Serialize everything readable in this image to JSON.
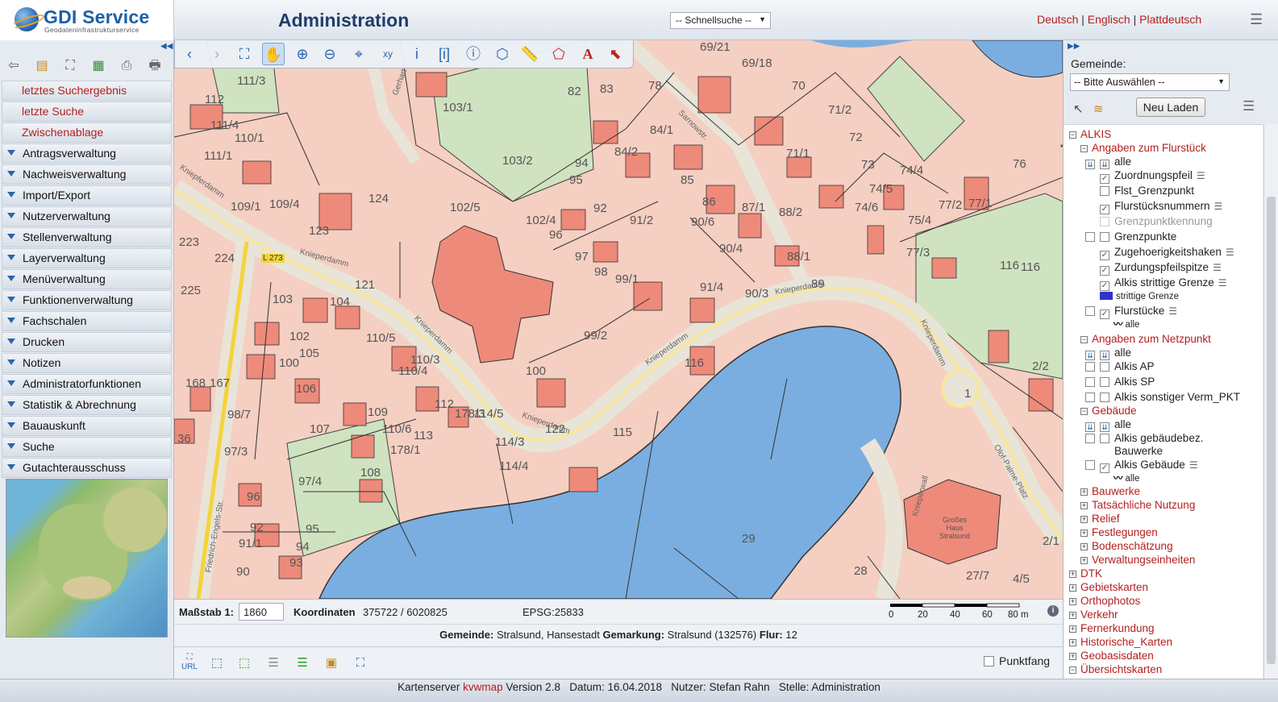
{
  "header": {
    "logo_name": "GDI Service",
    "logo_sub": "Geodateninfrastrukturservice",
    "title": "Administration",
    "quicksearch": "-- Schnellsuche --",
    "languages": [
      "Deutsch",
      "Englisch",
      "Plattdeutsch"
    ]
  },
  "sidebar": {
    "quick_links": [
      "letztes Suchergebnis",
      "letzte Suche",
      "Zwischenablage"
    ],
    "menu": [
      "Antragsverwaltung",
      "Nachweisverwaltung",
      "Import/Export",
      "Nutzerverwaltung",
      "Stellenverwaltung",
      "Layerverwaltung",
      "Menüverwaltung",
      "Funktionenverwaltung",
      "Fachschalen",
      "Drucken",
      "Notizen",
      "Administratorfunktionen",
      "Statistik & Abrechnung",
      "Bauauskunft",
      "Suche",
      "Gutachterausschuss"
    ]
  },
  "map": {
    "parcel_labels": [
      "111/3",
      "112",
      "111/4",
      "110/1",
      "111/1",
      "109/1",
      "109/4",
      "103/1",
      "103/2",
      "124",
      "102/5",
      "102/4",
      "123",
      "103/",
      "96",
      "95",
      "94",
      "92",
      "91/2",
      "84/1",
      "84/2",
      "85",
      "86",
      "90/6",
      "87/1",
      "88/2",
      "70",
      "71/2",
      "72",
      "71/1",
      "73",
      "74/4",
      "74/5",
      "74/6",
      "75/4",
      "77/2",
      "77/1",
      "77/3",
      "116",
      "76",
      "69/21",
      "69/18",
      "78",
      "82",
      "83",
      "97",
      "98",
      "99/1",
      "90/4",
      "91/4",
      "90/3",
      "88/1",
      "89",
      "223",
      "224",
      "225",
      "121",
      "103",
      "104",
      "102",
      "105",
      "100",
      "106",
      "107",
      "109",
      "110/5",
      "110/3",
      "110/4",
      "110/6",
      "112",
      "113",
      "114/5",
      "114/3",
      "114/4",
      "178/3",
      "178/1",
      "99/2",
      "100",
      "122",
      "116",
      "115",
      "108",
      "97/4",
      "168",
      "167",
      "98/7",
      "97/3",
      "36",
      "96",
      "95",
      "92",
      "91/1",
      "94",
      "93",
      "90",
      "29",
      "28",
      "27/7",
      "4/5",
      "2/1",
      "2/2",
      "1",
      "116"
    ],
    "street_labels": [
      "Kniepferdamm",
      "Knieperdamm",
      "Sarnowstr.",
      "Friedrich-Engels-Str.",
      "Olof-Palme-Platz",
      "Knieperwall",
      "Gerhart-"
    ],
    "building_label": "Großes Haus Stralsund",
    "road_ref": "L 273"
  },
  "status": {
    "scale_label": "Maßstab 1:",
    "scale_value": "1860",
    "coord_label": "Koordinaten",
    "coord_value": "375722 / 6020825",
    "epsg": "EPSG:25833",
    "scalebar_ticks": [
      "0",
      "20",
      "40",
      "60",
      "80 m"
    ],
    "location_text_1": "Gemeinde:",
    "location_val_1": "Stralsund, Hansestadt",
    "location_text_2": "Gemarkung:",
    "location_val_2": "Stralsund (132576)",
    "location_text_3": "Flur:",
    "location_val_3": "12",
    "punktfang": "Punktfang"
  },
  "right_panel": {
    "gemeinde_label": "Gemeinde:",
    "gemeinde_select": "-- Bitte Auswählen --",
    "reload": "Neu Laden",
    "tree": [
      {
        "label": "ALKIS",
        "type": "group",
        "state": "expanded"
      },
      {
        "label": "Angaben zum Flurstück",
        "type": "subgroup"
      },
      {
        "label": "alle",
        "type": "all"
      },
      {
        "label": "Zuordnungspfeil",
        "checked": true
      },
      {
        "label": "Flst_Grenzpunkt",
        "checked": false
      },
      {
        "label": "Flurstücksnummern",
        "checked": true
      },
      {
        "label": "Grenzpunktkennung",
        "checked": false,
        "disabled": true
      },
      {
        "label": "Grenzpunkte",
        "checked": false
      },
      {
        "label": "Zugehoerigkeitshaken",
        "checked": true
      },
      {
        "label": "Zurdungspfeilspitze",
        "checked": true
      },
      {
        "label": "Alkis strittige Grenze",
        "checked": true
      },
      {
        "label": "strittige Grenze",
        "type": "legend"
      },
      {
        "label": "Flurstücke",
        "checked": true
      },
      {
        "label": "alle",
        "type": "legend"
      },
      {
        "label": "Angaben zum Netzpunkt",
        "type": "subgroup"
      },
      {
        "label": "alle",
        "type": "all"
      },
      {
        "label": "Alkis AP",
        "checked": false
      },
      {
        "label": "Alkis SP",
        "checked": false
      },
      {
        "label": "Alkis sonstiger Verm_PKT",
        "checked": false
      },
      {
        "label": "Gebäude",
        "type": "subgroup"
      },
      {
        "label": "alle",
        "type": "all"
      },
      {
        "label": "Alkis gebäudebez.",
        "checked": false
      },
      {
        "label": "Bauwerke",
        "type": "continuation"
      },
      {
        "label": "Alkis Gebäude",
        "checked": true
      },
      {
        "label": "alle",
        "type": "legend"
      },
      {
        "label": "Bauwerke",
        "type": "collapsed"
      },
      {
        "label": "Tatsächliche Nutzung",
        "type": "collapsed"
      },
      {
        "label": "Relief",
        "type": "collapsed"
      },
      {
        "label": "Festlegungen",
        "type": "collapsed"
      },
      {
        "label": "Bodenschätzung",
        "type": "collapsed"
      },
      {
        "label": "Verwaltungseinheiten",
        "type": "collapsed"
      },
      {
        "label": "DTK",
        "type": "top"
      },
      {
        "label": "Gebietskarten",
        "type": "top"
      },
      {
        "label": "Orthophotos",
        "type": "top"
      },
      {
        "label": "Verkehr",
        "type": "top"
      },
      {
        "label": "Fernerkundung",
        "type": "top"
      },
      {
        "label": "Historische_Karten",
        "type": "top"
      },
      {
        "label": "Geobasisdaten",
        "type": "top"
      },
      {
        "label": "Übersichtskarten",
        "type": "top-open"
      }
    ]
  },
  "footer": {
    "t1": "Kartenserver",
    "brand": "kvwmap",
    "t2": "Version 2.8   Datum: 16.04.2018   Nutzer: Stefan Rahn   Stelle: Administration"
  },
  "colors": {
    "accent": "#1d5fa8",
    "link_red": "#b32020",
    "parcel": "#f5cfc2",
    "building": "#ee8a7a",
    "water": "#7aaee0",
    "green": "#cfe3c0"
  }
}
